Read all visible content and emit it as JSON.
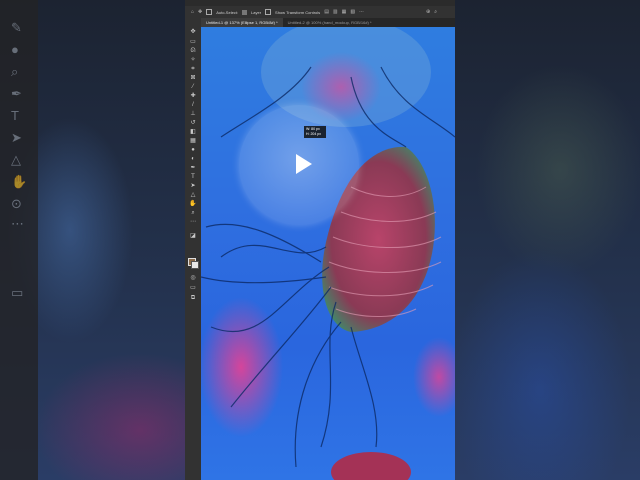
{
  "options_bar": {
    "auto_select_label": "Auto-Select:",
    "layer_dropdown": "Layer",
    "show_transform_label": "Show Transform Controls"
  },
  "tabs": [
    {
      "label": "Untitled-1 @ 137% (Ellipse 1, RGB/8#) *",
      "active": true
    },
    {
      "label": "Untitled-2 @ 100% (hand_mockup, RGB/16#) *",
      "active": false
    }
  ],
  "canvas": {
    "tooltip_w": "W: 80 px",
    "tooltip_h": "H: 204 px"
  },
  "colors": {
    "foreground": "#8a6a4a",
    "background": "#e8e8e8"
  }
}
